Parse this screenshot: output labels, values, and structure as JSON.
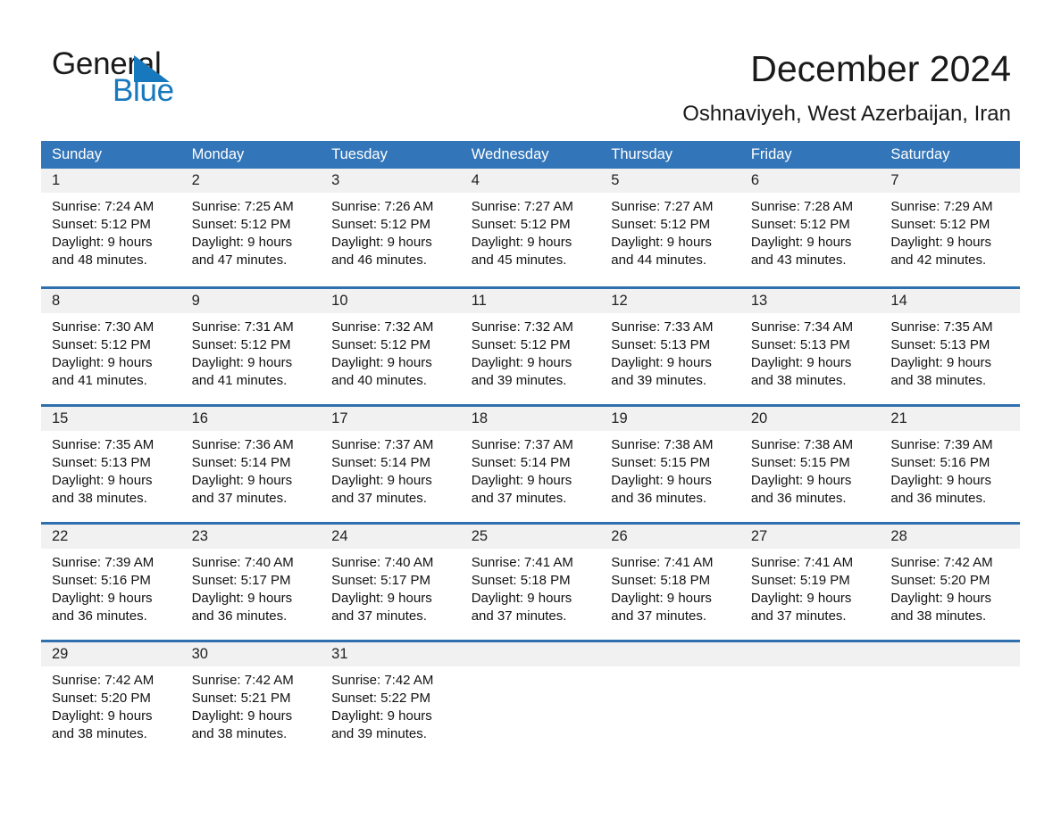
{
  "brand": {
    "name_part1": "General",
    "name_part2": "Blue",
    "accent_color": "#1878be",
    "triangle_icon": "triangle-icon"
  },
  "header": {
    "title": "December 2024",
    "subtitle": "Oshnaviyeh, West Azerbaijan, Iran"
  },
  "calendar": {
    "header_color": "#3275b8",
    "daynum_band_color": "#f1f1f1",
    "weekdays": [
      "Sunday",
      "Monday",
      "Tuesday",
      "Wednesday",
      "Thursday",
      "Friday",
      "Saturday"
    ],
    "weeks": [
      [
        {
          "day": "1",
          "sunrise": "Sunrise: 7:24 AM",
          "sunset": "Sunset: 5:12 PM",
          "daylight1": "Daylight: 9 hours",
          "daylight2": "and 48 minutes."
        },
        {
          "day": "2",
          "sunrise": "Sunrise: 7:25 AM",
          "sunset": "Sunset: 5:12 PM",
          "daylight1": "Daylight: 9 hours",
          "daylight2": "and 47 minutes."
        },
        {
          "day": "3",
          "sunrise": "Sunrise: 7:26 AM",
          "sunset": "Sunset: 5:12 PM",
          "daylight1": "Daylight: 9 hours",
          "daylight2": "and 46 minutes."
        },
        {
          "day": "4",
          "sunrise": "Sunrise: 7:27 AM",
          "sunset": "Sunset: 5:12 PM",
          "daylight1": "Daylight: 9 hours",
          "daylight2": "and 45 minutes."
        },
        {
          "day": "5",
          "sunrise": "Sunrise: 7:27 AM",
          "sunset": "Sunset: 5:12 PM",
          "daylight1": "Daylight: 9 hours",
          "daylight2": "and 44 minutes."
        },
        {
          "day": "6",
          "sunrise": "Sunrise: 7:28 AM",
          "sunset": "Sunset: 5:12 PM",
          "daylight1": "Daylight: 9 hours",
          "daylight2": "and 43 minutes."
        },
        {
          "day": "7",
          "sunrise": "Sunrise: 7:29 AM",
          "sunset": "Sunset: 5:12 PM",
          "daylight1": "Daylight: 9 hours",
          "daylight2": "and 42 minutes."
        }
      ],
      [
        {
          "day": "8",
          "sunrise": "Sunrise: 7:30 AM",
          "sunset": "Sunset: 5:12 PM",
          "daylight1": "Daylight: 9 hours",
          "daylight2": "and 41 minutes."
        },
        {
          "day": "9",
          "sunrise": "Sunrise: 7:31 AM",
          "sunset": "Sunset: 5:12 PM",
          "daylight1": "Daylight: 9 hours",
          "daylight2": "and 41 minutes."
        },
        {
          "day": "10",
          "sunrise": "Sunrise: 7:32 AM",
          "sunset": "Sunset: 5:12 PM",
          "daylight1": "Daylight: 9 hours",
          "daylight2": "and 40 minutes."
        },
        {
          "day": "11",
          "sunrise": "Sunrise: 7:32 AM",
          "sunset": "Sunset: 5:12 PM",
          "daylight1": "Daylight: 9 hours",
          "daylight2": "and 39 minutes."
        },
        {
          "day": "12",
          "sunrise": "Sunrise: 7:33 AM",
          "sunset": "Sunset: 5:13 PM",
          "daylight1": "Daylight: 9 hours",
          "daylight2": "and 39 minutes."
        },
        {
          "day": "13",
          "sunrise": "Sunrise: 7:34 AM",
          "sunset": "Sunset: 5:13 PM",
          "daylight1": "Daylight: 9 hours",
          "daylight2": "and 38 minutes."
        },
        {
          "day": "14",
          "sunrise": "Sunrise: 7:35 AM",
          "sunset": "Sunset: 5:13 PM",
          "daylight1": "Daylight: 9 hours",
          "daylight2": "and 38 minutes."
        }
      ],
      [
        {
          "day": "15",
          "sunrise": "Sunrise: 7:35 AM",
          "sunset": "Sunset: 5:13 PM",
          "daylight1": "Daylight: 9 hours",
          "daylight2": "and 38 minutes."
        },
        {
          "day": "16",
          "sunrise": "Sunrise: 7:36 AM",
          "sunset": "Sunset: 5:14 PM",
          "daylight1": "Daylight: 9 hours",
          "daylight2": "and 37 minutes."
        },
        {
          "day": "17",
          "sunrise": "Sunrise: 7:37 AM",
          "sunset": "Sunset: 5:14 PM",
          "daylight1": "Daylight: 9 hours",
          "daylight2": "and 37 minutes."
        },
        {
          "day": "18",
          "sunrise": "Sunrise: 7:37 AM",
          "sunset": "Sunset: 5:14 PM",
          "daylight1": "Daylight: 9 hours",
          "daylight2": "and 37 minutes."
        },
        {
          "day": "19",
          "sunrise": "Sunrise: 7:38 AM",
          "sunset": "Sunset: 5:15 PM",
          "daylight1": "Daylight: 9 hours",
          "daylight2": "and 36 minutes."
        },
        {
          "day": "20",
          "sunrise": "Sunrise: 7:38 AM",
          "sunset": "Sunset: 5:15 PM",
          "daylight1": "Daylight: 9 hours",
          "daylight2": "and 36 minutes."
        },
        {
          "day": "21",
          "sunrise": "Sunrise: 7:39 AM",
          "sunset": "Sunset: 5:16 PM",
          "daylight1": "Daylight: 9 hours",
          "daylight2": "and 36 minutes."
        }
      ],
      [
        {
          "day": "22",
          "sunrise": "Sunrise: 7:39 AM",
          "sunset": "Sunset: 5:16 PM",
          "daylight1": "Daylight: 9 hours",
          "daylight2": "and 36 minutes."
        },
        {
          "day": "23",
          "sunrise": "Sunrise: 7:40 AM",
          "sunset": "Sunset: 5:17 PM",
          "daylight1": "Daylight: 9 hours",
          "daylight2": "and 36 minutes."
        },
        {
          "day": "24",
          "sunrise": "Sunrise: 7:40 AM",
          "sunset": "Sunset: 5:17 PM",
          "daylight1": "Daylight: 9 hours",
          "daylight2": "and 37 minutes."
        },
        {
          "day": "25",
          "sunrise": "Sunrise: 7:41 AM",
          "sunset": "Sunset: 5:18 PM",
          "daylight1": "Daylight: 9 hours",
          "daylight2": "and 37 minutes."
        },
        {
          "day": "26",
          "sunrise": "Sunrise: 7:41 AM",
          "sunset": "Sunset: 5:18 PM",
          "daylight1": "Daylight: 9 hours",
          "daylight2": "and 37 minutes."
        },
        {
          "day": "27",
          "sunrise": "Sunrise: 7:41 AM",
          "sunset": "Sunset: 5:19 PM",
          "daylight1": "Daylight: 9 hours",
          "daylight2": "and 37 minutes."
        },
        {
          "day": "28",
          "sunrise": "Sunrise: 7:42 AM",
          "sunset": "Sunset: 5:20 PM",
          "daylight1": "Daylight: 9 hours",
          "daylight2": "and 38 minutes."
        }
      ],
      [
        {
          "day": "29",
          "sunrise": "Sunrise: 7:42 AM",
          "sunset": "Sunset: 5:20 PM",
          "daylight1": "Daylight: 9 hours",
          "daylight2": "and 38 minutes."
        },
        {
          "day": "30",
          "sunrise": "Sunrise: 7:42 AM",
          "sunset": "Sunset: 5:21 PM",
          "daylight1": "Daylight: 9 hours",
          "daylight2": "and 38 minutes."
        },
        {
          "day": "31",
          "sunrise": "Sunrise: 7:42 AM",
          "sunset": "Sunset: 5:22 PM",
          "daylight1": "Daylight: 9 hours",
          "daylight2": "and 39 minutes."
        },
        {
          "day": "",
          "sunrise": "",
          "sunset": "",
          "daylight1": "",
          "daylight2": ""
        },
        {
          "day": "",
          "sunrise": "",
          "sunset": "",
          "daylight1": "",
          "daylight2": ""
        },
        {
          "day": "",
          "sunrise": "",
          "sunset": "",
          "daylight1": "",
          "daylight2": ""
        },
        {
          "day": "",
          "sunrise": "",
          "sunset": "",
          "daylight1": "",
          "daylight2": ""
        }
      ]
    ]
  }
}
